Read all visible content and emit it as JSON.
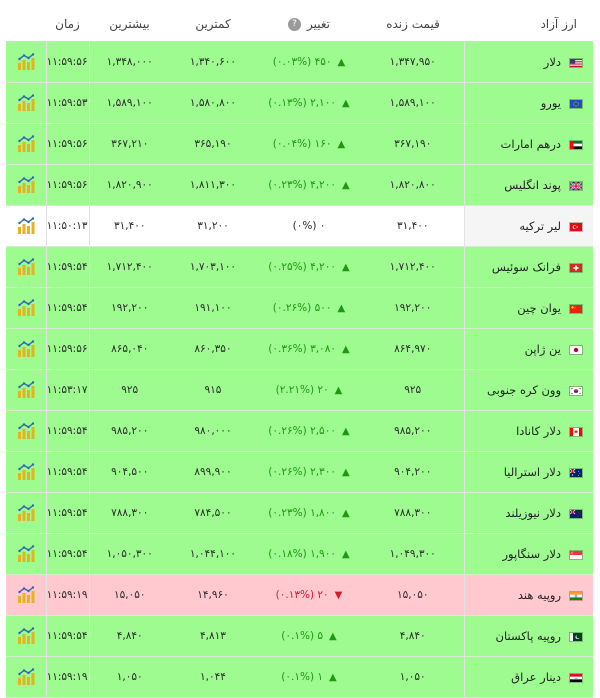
{
  "columns": {
    "name": "ارز آزاد",
    "live": "قیمت زنده",
    "change": "تغییر",
    "min": "کمترین",
    "max": "بیشترین",
    "time": "زمان"
  },
  "colors": {
    "up": "#9dfb90",
    "flat": "#ffffff",
    "down": "#ffc9cf",
    "up_text": "#1e9a10",
    "down_text": "#d61b2b"
  },
  "rows": [
    {
      "name": "دلار",
      "flag": "us",
      "live": "۱,۳۴۷,۹۵۰",
      "change": "۴۵۰ (۰.۰۳%)",
      "dir": "up",
      "min": "۱,۳۴۰,۶۰۰",
      "max": "۱,۳۴۸,۰۰۰",
      "time": "۱۱:۵۹:۵۶"
    },
    {
      "name": "یورو",
      "flag": "eu",
      "live": "۱,۵۸۹,۱۰۰",
      "change": "۲,۱۰۰ (۰.۱۳%)",
      "dir": "up",
      "min": "۱,۵۸۰,۸۰۰",
      "max": "۱,۵۸۹,۱۰۰",
      "time": "۱۱:۵۹:۵۳"
    },
    {
      "name": "درهم امارات",
      "flag": "ae",
      "live": "۳۶۷,۱۹۰",
      "change": "۱۶۰ (۰.۰۴%)",
      "dir": "up",
      "min": "۳۶۵,۱۹۰",
      "max": "۳۶۷,۲۱۰",
      "time": "۱۱:۵۹:۵۶"
    },
    {
      "name": "پوند انگلیس",
      "flag": "gb",
      "live": "۱,۸۲۰,۸۰۰",
      "change": "۴,۲۰۰ (۰.۲۳%)",
      "dir": "up",
      "min": "۱,۸۱۱,۳۰۰",
      "max": "۱,۸۲۰,۹۰۰",
      "time": "۱۱:۵۹:۵۶"
    },
    {
      "name": "لیر ترکیه",
      "flag": "tr",
      "live": "۳۱,۴۰۰",
      "change": "۰ (۰%)",
      "dir": "flat",
      "min": "۳۱,۲۰۰",
      "max": "۳۱,۴۰۰",
      "time": "۱۱:۵۰:۱۳"
    },
    {
      "name": "فرانک سوئیس",
      "flag": "ch",
      "live": "۱,۷۱۲,۴۰۰",
      "change": "۴,۲۰۰ (۰.۲۵%)",
      "dir": "up",
      "min": "۱,۷۰۳,۱۰۰",
      "max": "۱,۷۱۲,۴۰۰",
      "time": "۱۱:۵۹:۵۴"
    },
    {
      "name": "یوان چین",
      "flag": "cn",
      "live": "۱۹۲,۲۰۰",
      "change": "۵۰۰ (۰.۲۶%)",
      "dir": "up",
      "min": "۱۹۱,۱۰۰",
      "max": "۱۹۲,۲۰۰",
      "time": "۱۱:۵۹:۵۴"
    },
    {
      "name": "ین ژاپن",
      "flag": "jp",
      "live": "۸۶۴,۹۷۰",
      "change": "۳,۰۸۰ (۰.۳۶%)",
      "dir": "up",
      "min": "۸۶۰,۳۵۰",
      "max": "۸۶۵,۰۴۰",
      "time": "۱۱:۵۹:۵۶"
    },
    {
      "name": "وون کره جنوبی",
      "flag": "kr",
      "live": "۹۲۵",
      "change": "۲۰ (۲.۲۱%)",
      "dir": "up",
      "min": "۹۱۵",
      "max": "۹۲۵",
      "time": "۱۱:۵۳:۱۷"
    },
    {
      "name": "دلار کانادا",
      "flag": "ca",
      "live": "۹۸۵,۲۰۰",
      "change": "۲,۵۰۰ (۰.۲۶%)",
      "dir": "up",
      "min": "۹۸۰,۰۰۰",
      "max": "۹۸۵,۲۰۰",
      "time": "۱۱:۵۹:۵۴"
    },
    {
      "name": "دلار استرالیا",
      "flag": "au",
      "live": "۹۰۴,۲۰۰",
      "change": "۲,۳۰۰ (۰.۲۶%)",
      "dir": "up",
      "min": "۸۹۹,۹۰۰",
      "max": "۹۰۴,۵۰۰",
      "time": "۱۱:۵۹:۵۴"
    },
    {
      "name": "دلار نیوزیلند",
      "flag": "nz",
      "live": "۷۸۸,۳۰۰",
      "change": "۱,۸۰۰ (۰.۲۳%)",
      "dir": "up",
      "min": "۷۸۴,۵۰۰",
      "max": "۷۸۸,۳۰۰",
      "time": "۱۱:۵۹:۵۴"
    },
    {
      "name": "دلار سنگاپور",
      "flag": "sg",
      "live": "۱,۰۴۹,۳۰۰",
      "change": "۱,۹۰۰ (۰.۱۸%)",
      "dir": "up",
      "min": "۱,۰۴۴,۱۰۰",
      "max": "۱,۰۵۰,۳۰۰",
      "time": "۱۱:۵۹:۵۴"
    },
    {
      "name": "روپیه هند",
      "flag": "in",
      "live": "۱۵,۰۵۰",
      "change": "۲۰ (۰.۱۳%)",
      "dir": "down",
      "min": "۱۴,۹۶۰",
      "max": "۱۵,۰۵۰",
      "time": "۱۱:۵۹:۱۹"
    },
    {
      "name": "روپیه پاکستان",
      "flag": "pk",
      "live": "۴,۸۴۰",
      "change": "۵ (۰.۱%)",
      "dir": "up",
      "min": "۴,۸۱۳",
      "max": "۴,۸۴۰",
      "time": "۱۱:۵۹:۵۴"
    },
    {
      "name": "دینار عراق",
      "flag": "iq",
      "live": "۱,۰۵۰",
      "change": "۱ (۰.۱%)",
      "dir": "up",
      "min": "۱,۰۴۴",
      "max": "۱,۰۵۰",
      "time": "۱۱:۵۹:۱۹"
    }
  ]
}
